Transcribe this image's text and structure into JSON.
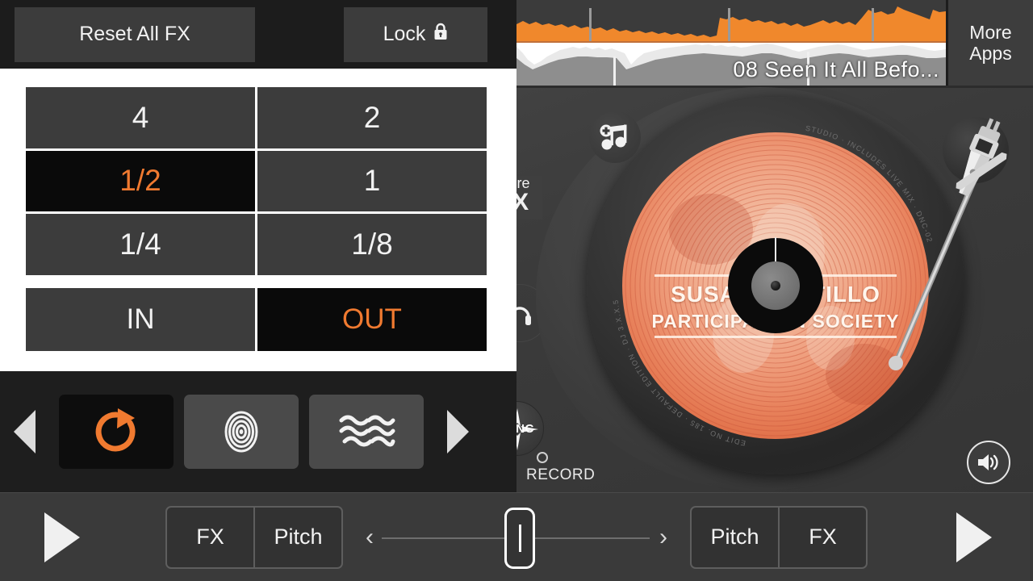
{
  "fx_panel": {
    "reset_label": "Reset All FX",
    "lock_label": "Lock",
    "lock_icon": "lock-icon",
    "beat_grid": {
      "cells": [
        {
          "label": "4",
          "active": false
        },
        {
          "label": "2",
          "active": false
        },
        {
          "label": "1/2",
          "active": true
        },
        {
          "label": "1",
          "active": false
        },
        {
          "label": "1/4",
          "active": false
        },
        {
          "label": "1/8",
          "active": false
        }
      ]
    },
    "inout": {
      "in_label": "IN",
      "out_label": "OUT",
      "in_active": false,
      "out_active": true
    },
    "fx_selector": {
      "prev_icon": "triangle-left-icon",
      "next_icon": "triangle-right-icon",
      "slots": [
        {
          "icon": "loop-repeat-icon",
          "active": true
        },
        {
          "icon": "concentric-circles-icon",
          "active": false
        },
        {
          "icon": "wavy-lines-icon",
          "active": false
        }
      ]
    }
  },
  "deck": {
    "track_title": "08 Seen It All Befo...",
    "more_apps_line1": "More",
    "more_apps_line2": "Apps",
    "more_fx_line1": "More",
    "more_fx_line2": "FX",
    "add_music_icon": "add-music-note-icon",
    "volume_icon": "speaker-volume-icon",
    "cue_icon": "headphones-icon",
    "sync_label": "SYNC",
    "record_label": "RECORD",
    "vinyl": {
      "artist": "SUSAN CASTILLO",
      "album": "PARTICIPATE IN SOCIETY",
      "rim_top_text": "STUDIO · INCLUDES LIVE MIX · DNC-02",
      "rim_bottom_text": "EDIT NO. 185 · DEFAULT EDITION · DJ 3.X.X.5"
    }
  },
  "bottom_bar": {
    "play_left_icon": "play-icon",
    "play_right_icon": "play-icon",
    "left_segment": [
      "FX",
      "Pitch"
    ],
    "right_segment": [
      "Pitch",
      "FX"
    ],
    "crossfader": {
      "left_chevron": "‹",
      "right_chevron": "›",
      "knob_icon": "crossfader-knob"
    }
  },
  "colors": {
    "accent_orange": "#F07A30",
    "panel_dark": "#1C1C1C",
    "cell_gray": "#3C3C3C",
    "active_black": "#0A0A0A",
    "deck_gray": "#3A3A3A",
    "text_white": "#F2F2F2"
  }
}
